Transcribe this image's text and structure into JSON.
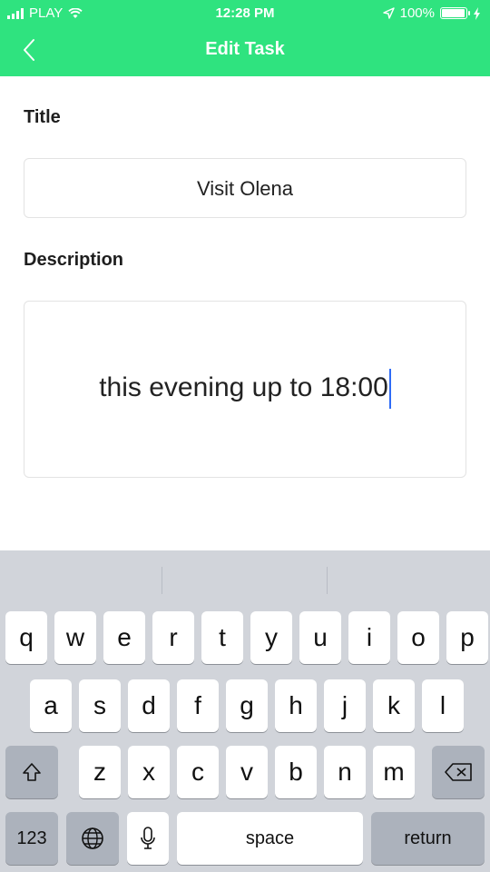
{
  "status": {
    "carrier": "PLAY",
    "time": "12:28 PM",
    "battery": "100%",
    "battery_level": 1.0
  },
  "nav": {
    "title": "Edit Task",
    "back_icon": "chevron-left-icon"
  },
  "form": {
    "title_label": "Title",
    "title_value": "Visit Olena",
    "description_label": "Description",
    "description_value": "this evening up to 18:00"
  },
  "keyboard": {
    "row1": [
      "q",
      "w",
      "e",
      "r",
      "t",
      "y",
      "u",
      "i",
      "o",
      "p"
    ],
    "row2": [
      "a",
      "s",
      "d",
      "f",
      "g",
      "h",
      "j",
      "k",
      "l"
    ],
    "row3": [
      "z",
      "x",
      "c",
      "v",
      "b",
      "n",
      "m"
    ],
    "numbers_key": "123",
    "space_key": "space",
    "return_key": "return"
  },
  "colors": {
    "accent": "#2fe37f",
    "caret": "#2f6cf6"
  }
}
